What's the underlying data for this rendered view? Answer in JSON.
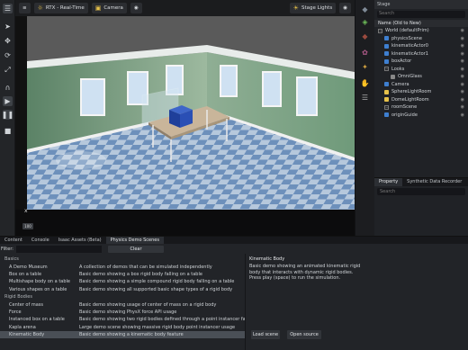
{
  "viewport_toolbar": {
    "renderer_label": "RTX - Real-Time",
    "camera_label": "Camera",
    "lights_label": "Stage Lights"
  },
  "viewport": {
    "axis_label": "x",
    "fps_badge": "100"
  },
  "stage": {
    "header": "Stage",
    "search_label": "Search",
    "column_header": "Name (Old to New)",
    "tree": [
      {
        "label": "World (defaultPrim)",
        "indent": 0,
        "kind": "expand"
      },
      {
        "label": "physicsScene",
        "indent": 1,
        "kind": "blue"
      },
      {
        "label": "kinematicActor0",
        "indent": 1,
        "kind": "blue"
      },
      {
        "label": "kinematicActor1",
        "indent": 1,
        "kind": "blue"
      },
      {
        "label": "boxActor",
        "indent": 1,
        "kind": "blue"
      },
      {
        "label": "Looks",
        "indent": 1,
        "kind": "expand"
      },
      {
        "label": "OmniGlass",
        "indent": 2,
        "kind": "white"
      },
      {
        "label": "Camera",
        "indent": 1,
        "kind": "blue"
      },
      {
        "label": "SphereLightRoom",
        "indent": 1,
        "kind": "yellow"
      },
      {
        "label": "DomeLightRoom",
        "indent": 1,
        "kind": "yellow"
      },
      {
        "label": "roomScene",
        "indent": 1,
        "kind": "expand"
      },
      {
        "label": "originGuide",
        "indent": 1,
        "kind": "blue"
      }
    ]
  },
  "property_panel": {
    "tabs": [
      "Property",
      "Synthetic Data Recorder",
      "Re"
    ],
    "search_label": "Search"
  },
  "bottom_panel": {
    "tabs": [
      "Content",
      "Console",
      "Isaac Assets (Beta)",
      "Physics Demo Scenes"
    ],
    "filter_label": "Filter:",
    "clear_label": "Clear",
    "rows": [
      {
        "name": "Basics",
        "desc": "",
        "type": "cat"
      },
      {
        "name": "A Demo Museum",
        "desc": "A collection of demos that can be simulated independently"
      },
      {
        "name": "Box on a table",
        "desc": "Basic demo showing a box rigid body falling on a table"
      },
      {
        "name": "Multishape body on a table",
        "desc": "Basic demo showing a simple compound rigid body falling on a table"
      },
      {
        "name": "Various shapes on a table",
        "desc": "Basic demo showing all supported basic shape types of a rigid body"
      },
      {
        "name": "Rigid Bodies",
        "desc": "",
        "type": "cat"
      },
      {
        "name": "Center of mass",
        "desc": "Basic demo showing usage of center of mass on a rigid body"
      },
      {
        "name": "Force",
        "desc": "Basic demo showing PhysX force API usage"
      },
      {
        "name": "Instanced box on a table",
        "desc": "Basic demo showing two rigid bodies defined through a point instancer falling o"
      },
      {
        "name": "Kapla arena",
        "desc": "Large demo scene showing massive rigid body point instancer usage"
      },
      {
        "name": "Kinematic Body",
        "desc": "Basic demo showing a kinematic body feature",
        "type": "sel"
      }
    ],
    "detail": {
      "title": "Kinematic Body",
      "description": "Basic demo showing an animated kinematic rigid body that interacts with dynamic rigid bodies. Press play (space) to run the simulation.",
      "load_label": "Load scene",
      "open_label": "Open source"
    }
  }
}
